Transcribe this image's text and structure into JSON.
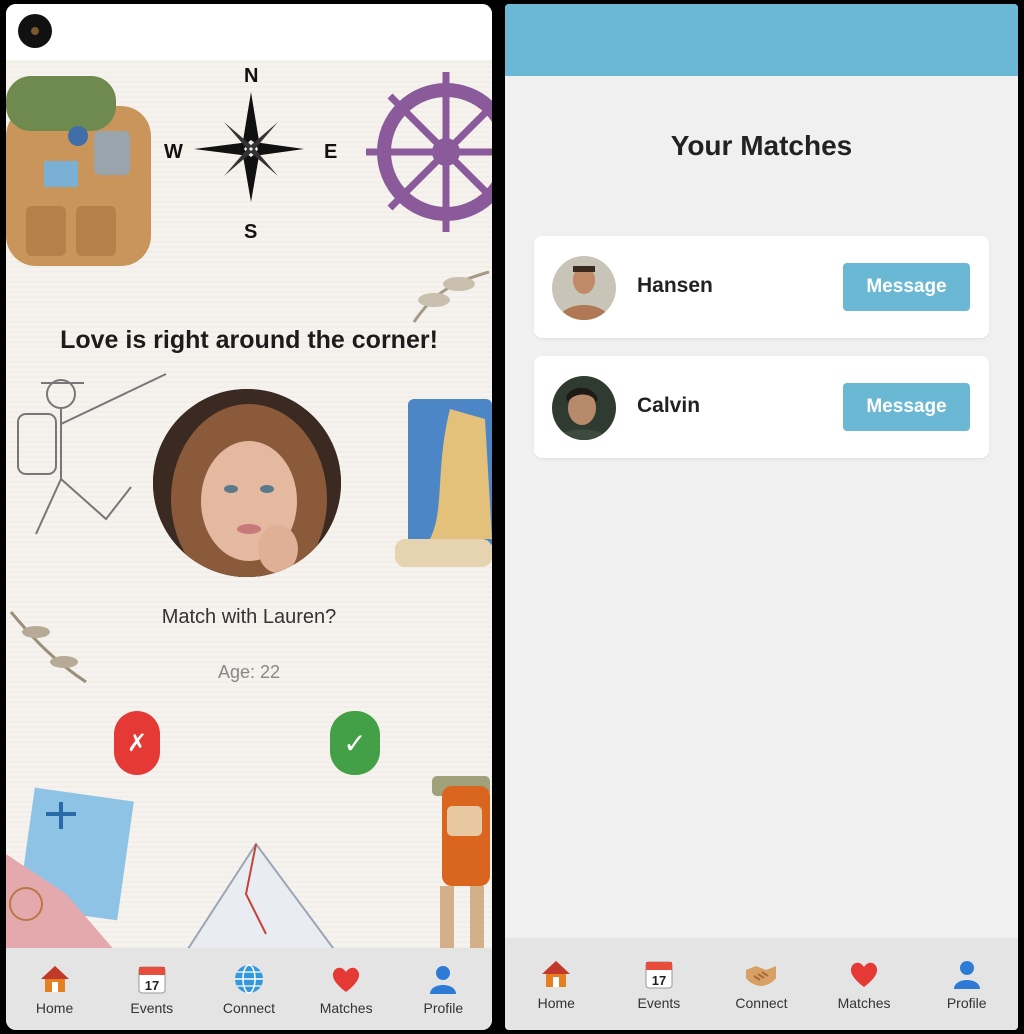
{
  "left_screen": {
    "tagline": "Love is right around the corner!",
    "compass": {
      "n": "N",
      "e": "E",
      "s": "S",
      "w": "W"
    },
    "match_prompt": "Match with Lauren?",
    "age": "Age: 22",
    "reject_symbol": "✗",
    "accept_symbol": "✓",
    "nav": [
      {
        "label": "Home",
        "icon": "house-icon"
      },
      {
        "label": "Events",
        "icon": "calendar-icon",
        "date": "17"
      },
      {
        "label": "Connect",
        "icon": "globe-icon"
      },
      {
        "label": "Matches",
        "icon": "heart-icon"
      },
      {
        "label": "Profile",
        "icon": "person-icon"
      }
    ]
  },
  "right_screen": {
    "title": "Your Matches",
    "matches": [
      {
        "name": "Hansen",
        "button": "Message"
      },
      {
        "name": "Calvin",
        "button": "Message"
      }
    ],
    "nav": [
      {
        "label": "Home",
        "icon": "house-icon"
      },
      {
        "label": "Events",
        "icon": "calendar-icon",
        "date": "17"
      },
      {
        "label": "Connect",
        "icon": "handshake-icon"
      },
      {
        "label": "Matches",
        "icon": "heart-icon"
      },
      {
        "label": "Profile",
        "icon": "person-icon"
      }
    ]
  },
  "colors": {
    "accent_blue": "#6bb8d4",
    "reject_red": "#e53935",
    "accept_green": "#43a047"
  }
}
